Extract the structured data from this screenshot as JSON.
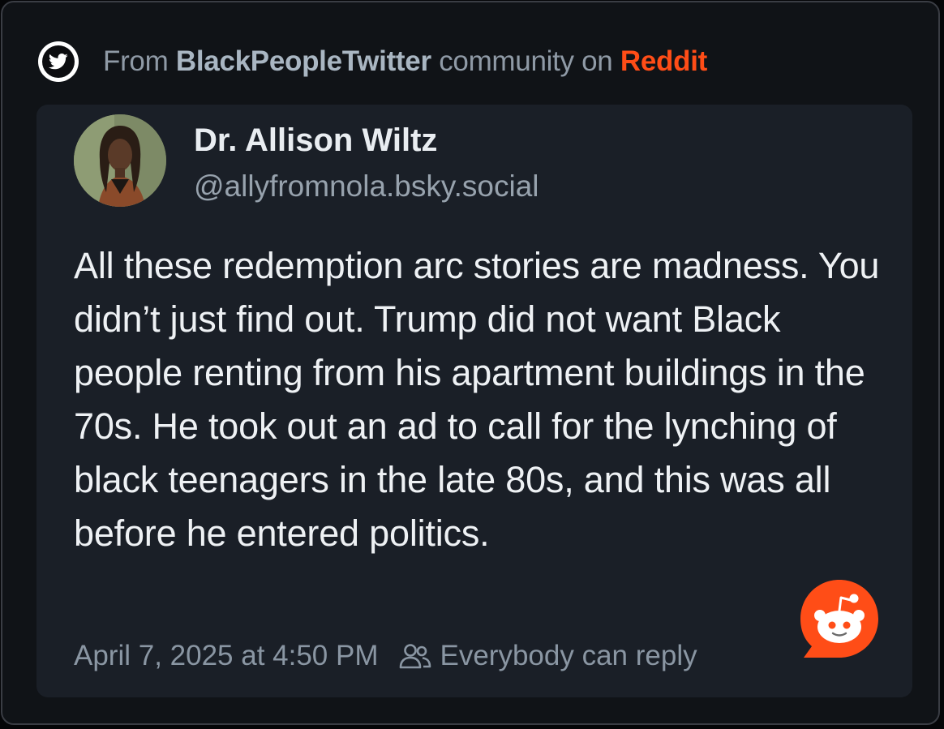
{
  "header": {
    "prefix": "From ",
    "community": "BlackPeopleTwitter",
    "middle": " community on ",
    "platform": "Reddit",
    "icon": "twitter-bird-icon"
  },
  "post": {
    "author_name": "Dr. Allison Wiltz",
    "author_handle": "@allyfromnola.bsky.social",
    "body": "All these redemption arc stories are madness. You didn’t just find out. Trump did not want Black people renting from his apartment buildings in the 70s. He took out an ad to call for the lynching of black teenagers in the late 80s, and this was all before he entered politics.",
    "timestamp": "April 7, 2025 at 4:50 PM",
    "reply_setting": "Everybody can reply"
  },
  "colors": {
    "background": "#101317",
    "card": "#1a1f27",
    "reddit_orange": "#ff4d17",
    "text_primary": "#eef1f4",
    "text_muted": "#8a96a3"
  }
}
